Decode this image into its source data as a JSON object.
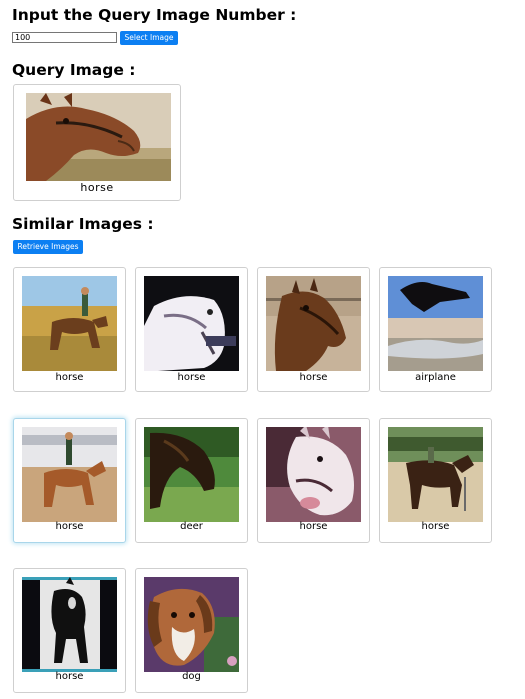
{
  "input_section": {
    "heading": "Input the Query Image Number :",
    "input_value": "100",
    "select_button_label": "Select Image"
  },
  "query_section": {
    "heading": "Query Image :",
    "image": {
      "label": "horse"
    }
  },
  "similar_section": {
    "heading": "Similar Images :",
    "retrieve_button_label": "Retrieve Images",
    "results": [
      {
        "label": "horse"
      },
      {
        "label": "horse"
      },
      {
        "label": "horse"
      },
      {
        "label": "airplane"
      },
      {
        "label": "horse"
      },
      {
        "label": "deer"
      },
      {
        "label": "horse"
      },
      {
        "label": "horse"
      },
      {
        "label": "horse"
      },
      {
        "label": "dog"
      }
    ]
  },
  "colors": {
    "button": "#0c7ff2",
    "card_border": "#cfcfcf",
    "focus_glow": "#bfe4f3"
  }
}
